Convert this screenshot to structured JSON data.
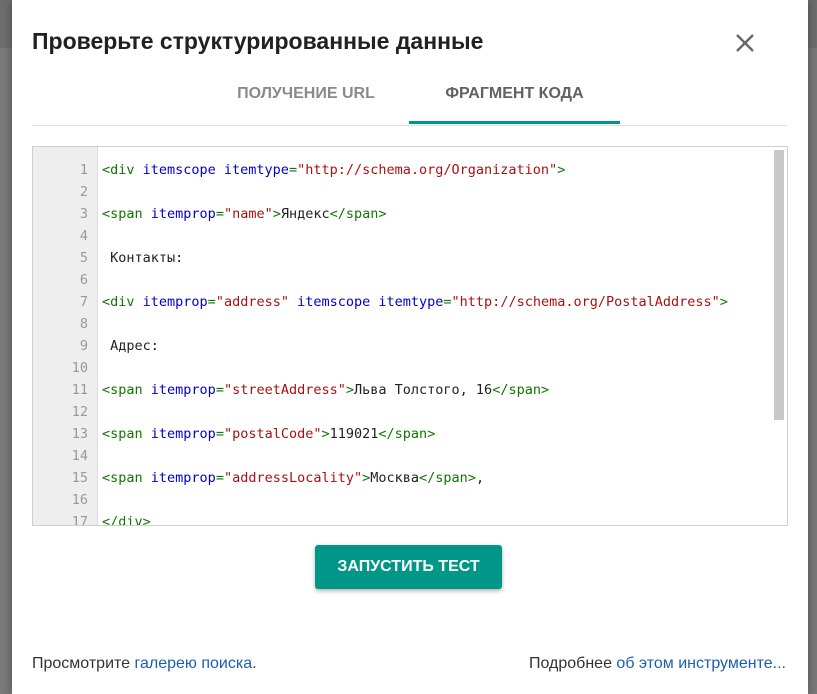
{
  "dialog": {
    "title": "Проверьте структурированные данные"
  },
  "tabs": [
    {
      "label": "ПОЛУЧЕНИЕ URL",
      "active": false
    },
    {
      "label": "ФРАГМЕНТ КОДА",
      "active": true
    }
  ],
  "editor": {
    "line_numbers": [
      "1",
      "2",
      "3",
      "4",
      "5",
      "6",
      "7",
      "8",
      "9",
      "10",
      "11",
      "12",
      "13",
      "14",
      "15",
      "16",
      "17"
    ],
    "lines": [
      [
        [
          "t",
          "<div "
        ],
        [
          "a",
          "itemscope itemtype"
        ],
        [
          "t",
          "="
        ],
        [
          "s",
          "\"http://schema.org/Organization\""
        ],
        [
          "t",
          ">"
        ]
      ],
      [],
      [
        [
          "t",
          "<span "
        ],
        [
          "a",
          "itemprop"
        ],
        [
          "t",
          "="
        ],
        [
          "s",
          "\"name\""
        ],
        [
          "t",
          ">"
        ],
        [
          "p",
          "Яндекс"
        ],
        [
          "t",
          "</span>"
        ]
      ],
      [],
      [
        [
          "p",
          " Контакты:"
        ]
      ],
      [],
      [
        [
          "t",
          "<div "
        ],
        [
          "a",
          "itemprop"
        ],
        [
          "t",
          "="
        ],
        [
          "s",
          "\"address\""
        ],
        [
          "a",
          " itemscope itemtype"
        ],
        [
          "t",
          "="
        ],
        [
          "s",
          "\"http://schema.org/PostalAddress\""
        ],
        [
          "t",
          ">"
        ]
      ],
      [],
      [
        [
          "p",
          " Адрес:"
        ]
      ],
      [],
      [
        [
          "t",
          "<span "
        ],
        [
          "a",
          "itemprop"
        ],
        [
          "t",
          "="
        ],
        [
          "s",
          "\"streetAddress\""
        ],
        [
          "t",
          ">"
        ],
        [
          "p",
          "Льва Толстого, 16"
        ],
        [
          "t",
          "</span>"
        ]
      ],
      [],
      [
        [
          "t",
          "<span "
        ],
        [
          "a",
          "itemprop"
        ],
        [
          "t",
          "="
        ],
        [
          "s",
          "\"postalCode\""
        ],
        [
          "t",
          ">"
        ],
        [
          "p",
          "119021"
        ],
        [
          "t",
          "</span>"
        ]
      ],
      [],
      [
        [
          "t",
          "<span "
        ],
        [
          "a",
          "itemprop"
        ],
        [
          "t",
          "="
        ],
        [
          "s",
          "\"addressLocality\""
        ],
        [
          "t",
          ">"
        ],
        [
          "p",
          "Москва"
        ],
        [
          "t",
          "</span>"
        ],
        [
          "p",
          ","
        ]
      ],
      [],
      [
        [
          "t",
          "</div>"
        ]
      ]
    ]
  },
  "actions": {
    "run_label": "ЗАПУСТИТЬ ТЕСТ"
  },
  "footer": {
    "left_text": "Просмотрите ",
    "left_link": "галерею поиска",
    "left_suffix": ".",
    "right_text": "Подробнее ",
    "right_link": "об этом инструменте..."
  },
  "colors": {
    "accent": "#009688",
    "tag": "#117700",
    "attribute": "#0000cc",
    "string": "#aa1111",
    "link": "#1a5fb4"
  },
  "icons": {
    "close": "close-icon"
  }
}
